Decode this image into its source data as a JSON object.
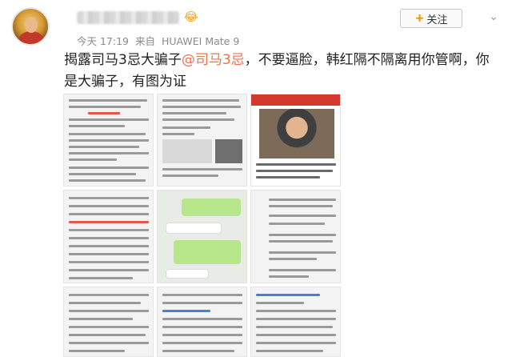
{
  "post": {
    "time": "今天 17:19",
    "source_prefix": "来自",
    "source_device": "HUAWEI Mate 9",
    "text_part1": "揭露司马3忌大骗子",
    "mention": "@司马3忌",
    "text_part2": "，不要逼脸，韩红隔不隔离用你管啊，你是大骗子，有图为证"
  },
  "header": {
    "follow_label": "关注",
    "follow_plus": "+",
    "menu_glyph": "⌄",
    "badge_emoji": "😂"
  },
  "icons": [
    "avatar",
    "chevron-down-icon",
    "plus-icon"
  ],
  "colors": {
    "mention": "#eb7350",
    "follow_plus": "#ff8200",
    "meta": "#8a8a8a",
    "netease_red": "#d33a2c",
    "wechat_green": "#b7e68b"
  }
}
